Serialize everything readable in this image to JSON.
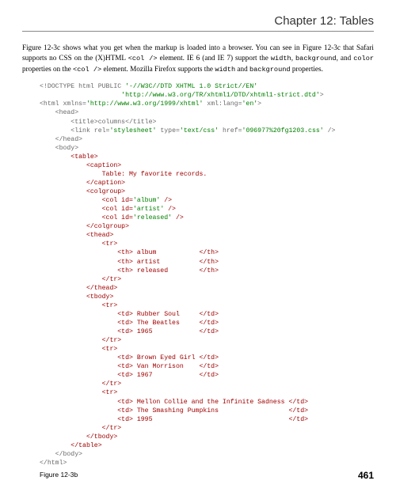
{
  "chapter_title": "Chapter 12: Tables",
  "body_text": {
    "run1": "Figure 12-3c shows what you get when the markup is loaded into a browser. You can see in Figure 12-3c that Safari supports no CSS on the (X)HTML ",
    "code1": "<col />",
    "run2": " element. IE 6 (and IE 7) support the ",
    "code2": "width",
    "run3": ", ",
    "code3": "background",
    "run4": ", and ",
    "code4": "color",
    "run5": " properties on the ",
    "code5": "<col />",
    "run6": " element. Mozilla Firefox supports the ",
    "code6": "width",
    "run7": " and ",
    "code7": "background",
    "run8": " properties."
  },
  "code": {
    "l01a": "<!DOCTYPE html PUBLIC ",
    "l01b": "'-//W3C//DTD XHTML 1.0 Strict//EN'",
    "l02": "                     'http://www.w3.org/TR/xhtml1/DTD/xhtml1-strict.dtd'",
    "l02z": ">",
    "l03a": "<html xmlns=",
    "l03b": "'http://www.w3.org/1999/xhtml'",
    "l03c": " xml:lang=",
    "l03d": "'en'",
    "l03e": ">",
    "l04": "    <head>",
    "l05": "        <title>columns</title>",
    "l06a": "        <link rel=",
    "l06b": "'stylesheet'",
    "l06c": " type=",
    "l06d": "'text/css'",
    "l06e": " href=",
    "l06f": "'096977%20fg1203.css'",
    "l06g": " />",
    "l07": "    </head>",
    "l08": "    <body>",
    "l09": "        <table>",
    "l10": "            <caption>",
    "l11": "                Table: My favorite records.",
    "l12": "            </caption>",
    "l13": "            <colgroup>",
    "l14a": "                <col id=",
    "l14b": "'album'",
    "l14c": " />",
    "l15a": "                <col id=",
    "l15b": "'artist'",
    "l15c": " />",
    "l16a": "                <col id=",
    "l16b": "'released'",
    "l16c": " />",
    "l17": "            </colgroup>",
    "l18": "            <thead>",
    "l19": "                <tr>",
    "l20": "                    <th> album           </th>",
    "l21": "                    <th> artist          </th>",
    "l22": "                    <th> released        </th>",
    "l23": "                </tr>",
    "l24": "            </thead>",
    "l25": "            <tbody>",
    "l26": "                <tr>",
    "l27": "                    <td> Rubber Soul     </td>",
    "l28": "                    <td> The Beatles     </td>",
    "l29": "                    <td> 1965            </td>",
    "l30": "                </tr>",
    "l31": "                <tr>",
    "l32": "                    <td> Brown Eyed Girl </td>",
    "l33": "                    <td> Van Morrison    </td>",
    "l34": "                    <td> 1967            </td>",
    "l35": "                </tr>",
    "l36": "                <tr>",
    "l37": "                    <td> Mellon Collie and the Infinite Sadness </td>",
    "l38": "                    <td> The Smashing Pumpkins                  </td>",
    "l39": "                    <td> 1995                                   </td>",
    "l40": "                </tr>",
    "l41": "            </tbody>",
    "l42": "        </table>",
    "l43": "    </body>",
    "l44": "</html>"
  },
  "figure_label": "Figure 12-3b",
  "page_number": "461",
  "chart_data": {
    "type": "table",
    "caption": "Table: My favorite records.",
    "columns": [
      "album",
      "artist",
      "released"
    ],
    "rows": [
      [
        "Rubber Soul",
        "The Beatles",
        "1965"
      ],
      [
        "Brown Eyed Girl",
        "Van Morrison",
        "1967"
      ],
      [
        "Mellon Collie and the Infinite Sadness",
        "The Smashing Pumpkins",
        "1995"
      ]
    ]
  }
}
